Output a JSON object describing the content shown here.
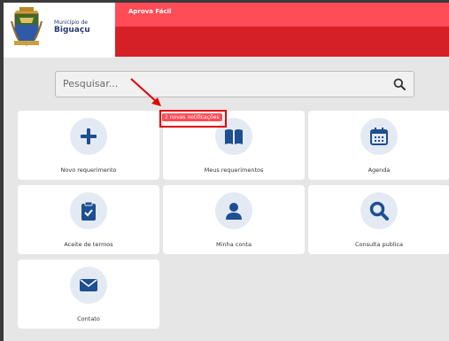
{
  "header": {
    "municipality_prefix": "Município de",
    "municipality_name": "Biguaçu",
    "app_title": "Aprova Fácil"
  },
  "search": {
    "placeholder": "Pesquisar..."
  },
  "notification": {
    "text": "2 novas notificações"
  },
  "tiles": [
    {
      "label": "Novo requerimento",
      "icon": "plus-icon"
    },
    {
      "label": "Meus requerimentos",
      "icon": "book-icon"
    },
    {
      "label": "Agenda",
      "icon": "calendar-icon"
    },
    {
      "label": "Aceite de termos",
      "icon": "clipboard-check-icon"
    },
    {
      "label": "Minha conta",
      "icon": "user-icon"
    },
    {
      "label": "Consulta publica",
      "icon": "search-icon"
    },
    {
      "label": "Contato",
      "icon": "envelope-icon"
    }
  ],
  "colors": {
    "header_light": "#ff4c57",
    "header_dark": "#d62028",
    "icon_blue": "#1d4f91",
    "icon_bg": "#e4eaf4",
    "annotation_red": "#e00000"
  }
}
